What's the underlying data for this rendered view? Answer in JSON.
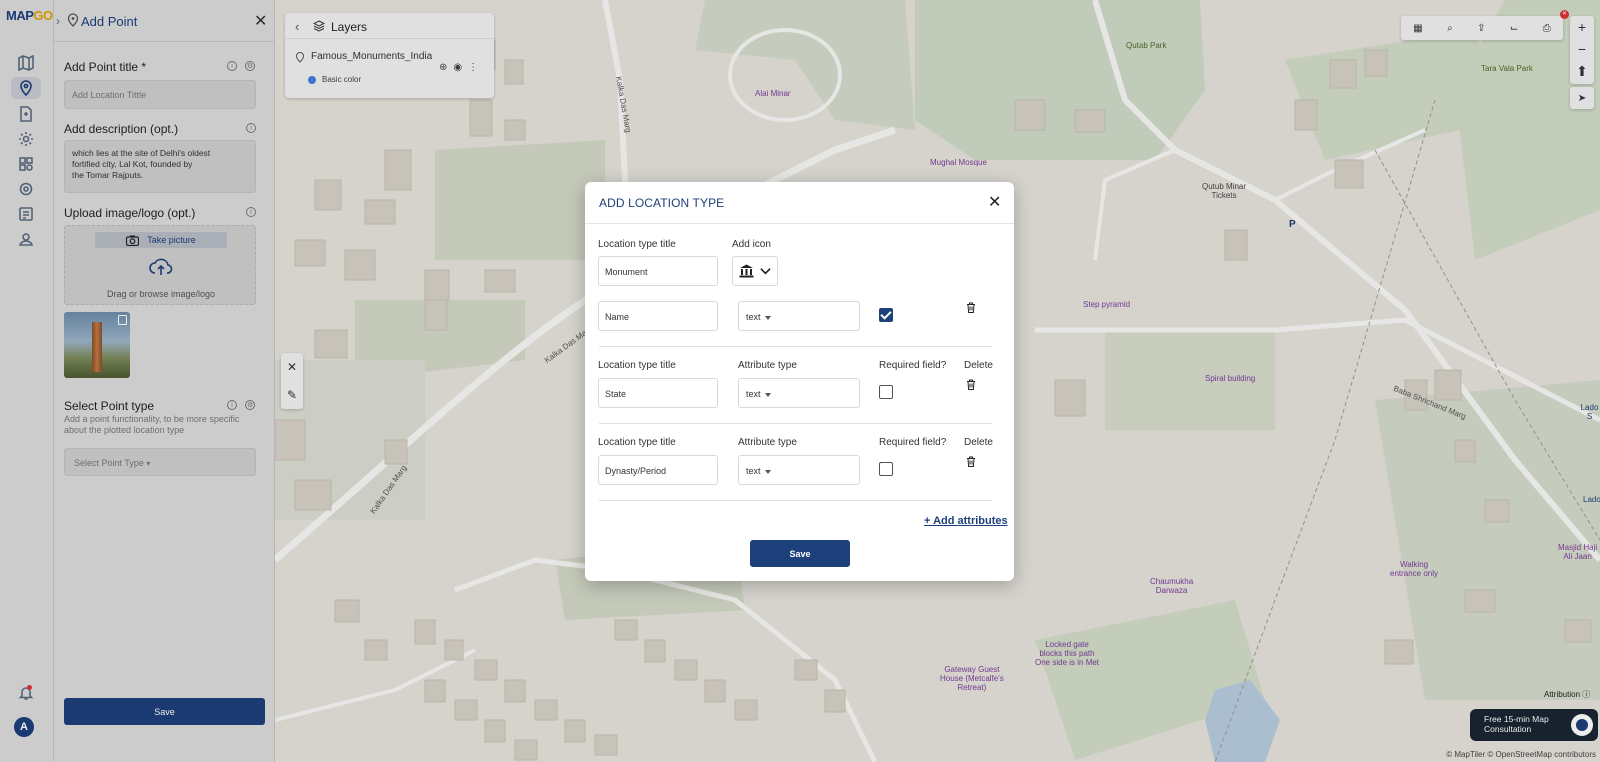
{
  "app": {
    "logo_text": "MAP",
    "logo_accent": "GO"
  },
  "panel": {
    "title": "Add Point",
    "point_title_label": "Add Point title *",
    "point_title_placeholder": "Add Location Tittle",
    "description_label": "Add description (opt.)",
    "description_value": "which lies at the site of Delhi's oldest\nfortified city, Lal Kot, founded by\nthe Tomar Rajputs.",
    "upload_label": "Upload image/logo (opt.)",
    "take_picture": "Take picture",
    "drag_browse": "Drag or browse image/logo",
    "point_type_label": "Select Point type",
    "point_type_hint": "Add a point functionality, to be more specific about the plotted location type",
    "point_type_placeholder": "Select Point Type",
    "save_label": "Save"
  },
  "layers": {
    "title": "Layers",
    "layer_name": "Famous_Monuments_India",
    "style_label": "Basic color"
  },
  "map": {
    "labels": {
      "alai_minar": "Alai Minar",
      "mughal_mosque": "Mughal Mosque",
      "qutab_park": "Qutab Park",
      "tara_vala_park": "Tara Vala Park",
      "qutub_tickets": "Qutub Minar\nTickets",
      "step_pyramid": "Step pyramid",
      "spiral_building": "Spiral building",
      "chaumukha": "Chaumukha\nDarwaza",
      "walking": "Walking\nentrance only",
      "masjid": "Masjid Haji\nAli Jaan",
      "locked_gate": "Locked gate\nblocks this path\nOne side is in Met",
      "gateway": "Gateway Guest\nHouse (Metcalfe's\nRetreat)",
      "parking": "P",
      "lado1": "Lado S",
      "lado2": "Lado"
    },
    "roads": {
      "kalka1": "Kalka Das Marg",
      "kalka2": "Kalka Das Marg",
      "kalka3": "Kalka Das Marg",
      "baba": "Baba Shrichand Marg"
    },
    "attribution_label": "Attribution",
    "attribution_text": "© MapTiler © OpenStreetMap contributors",
    "chat_text": "Free 15-min Map\nConsultation"
  },
  "modal": {
    "title": "ADD LOCATION TYPE",
    "type_title_label": "Location type title",
    "type_title_value": "Monument",
    "add_icon_label": "Add icon",
    "rows": [
      {
        "title_label": "",
        "attr_label": "",
        "req_label": "",
        "del_label": "",
        "value": "Name",
        "type": "text",
        "required": true
      },
      {
        "title_label": "Location type title",
        "attr_label": "Attribute type",
        "req_label": "Required field?",
        "del_label": "Delete",
        "value": "State",
        "type": "text",
        "required": false
      },
      {
        "title_label": "Location type title",
        "attr_label": "Attribute type",
        "req_label": "Required field?",
        "del_label": "Delete",
        "value": "Dynasty/Period",
        "type": "text",
        "required": false
      }
    ],
    "add_attributes": "+ Add attributes",
    "save_label": "Save"
  },
  "colors": {
    "brand": "#1d3f7a",
    "accent": "#e0a300"
  }
}
